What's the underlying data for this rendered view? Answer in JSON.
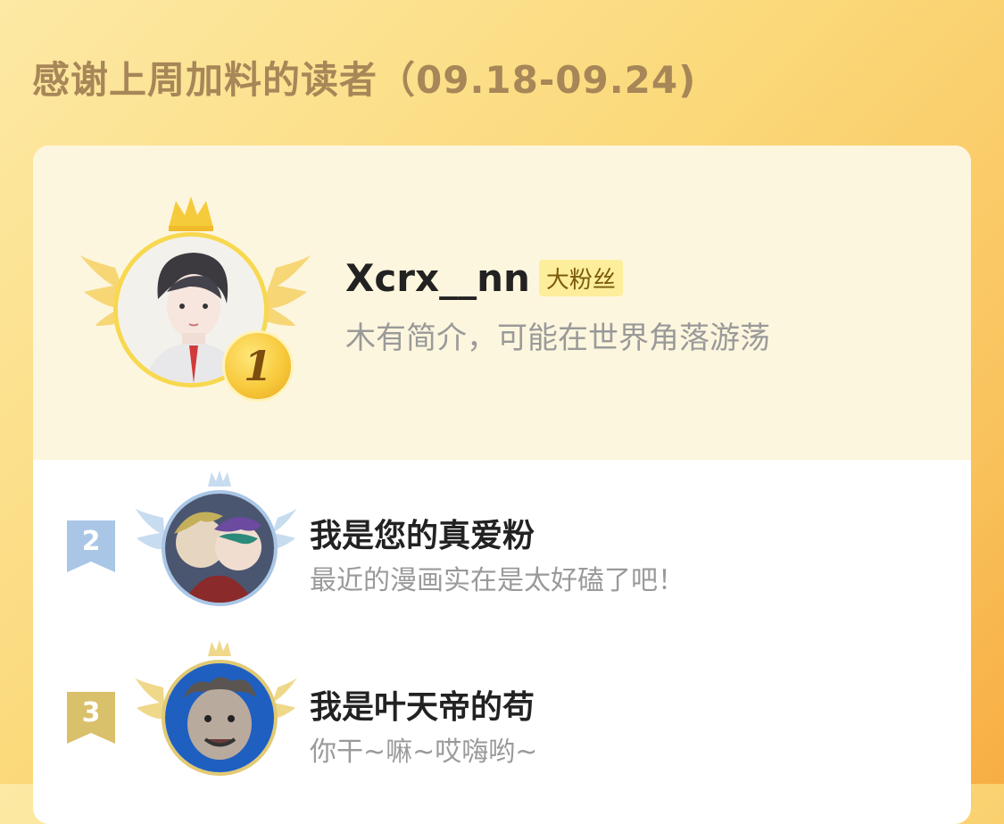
{
  "header": {
    "title": "感谢上周加料的读者（09.18-09.24)"
  },
  "leaderboard": {
    "first": {
      "rank": "1",
      "name": "Xcrx__nn",
      "badge": "大粉丝",
      "bio": "木有简介，可能在世界角落游荡"
    },
    "others": [
      {
        "rank": "2",
        "name": "我是您的真爱粉",
        "bio": "最近的漫画实在是太好磕了吧！"
      },
      {
        "rank": "3",
        "name": "我是叶天帝的苟",
        "bio": "你干~嘛~哎嗨哟~"
      }
    ]
  },
  "colors": {
    "gold": "#f7d84f",
    "silver": "#a9c6e6",
    "bronze": "#d9c06a",
    "title": "#a78658"
  },
  "icons": [
    "crown-icon",
    "wings-icon",
    "rank-medal-icon",
    "rank-flag-icon"
  ]
}
